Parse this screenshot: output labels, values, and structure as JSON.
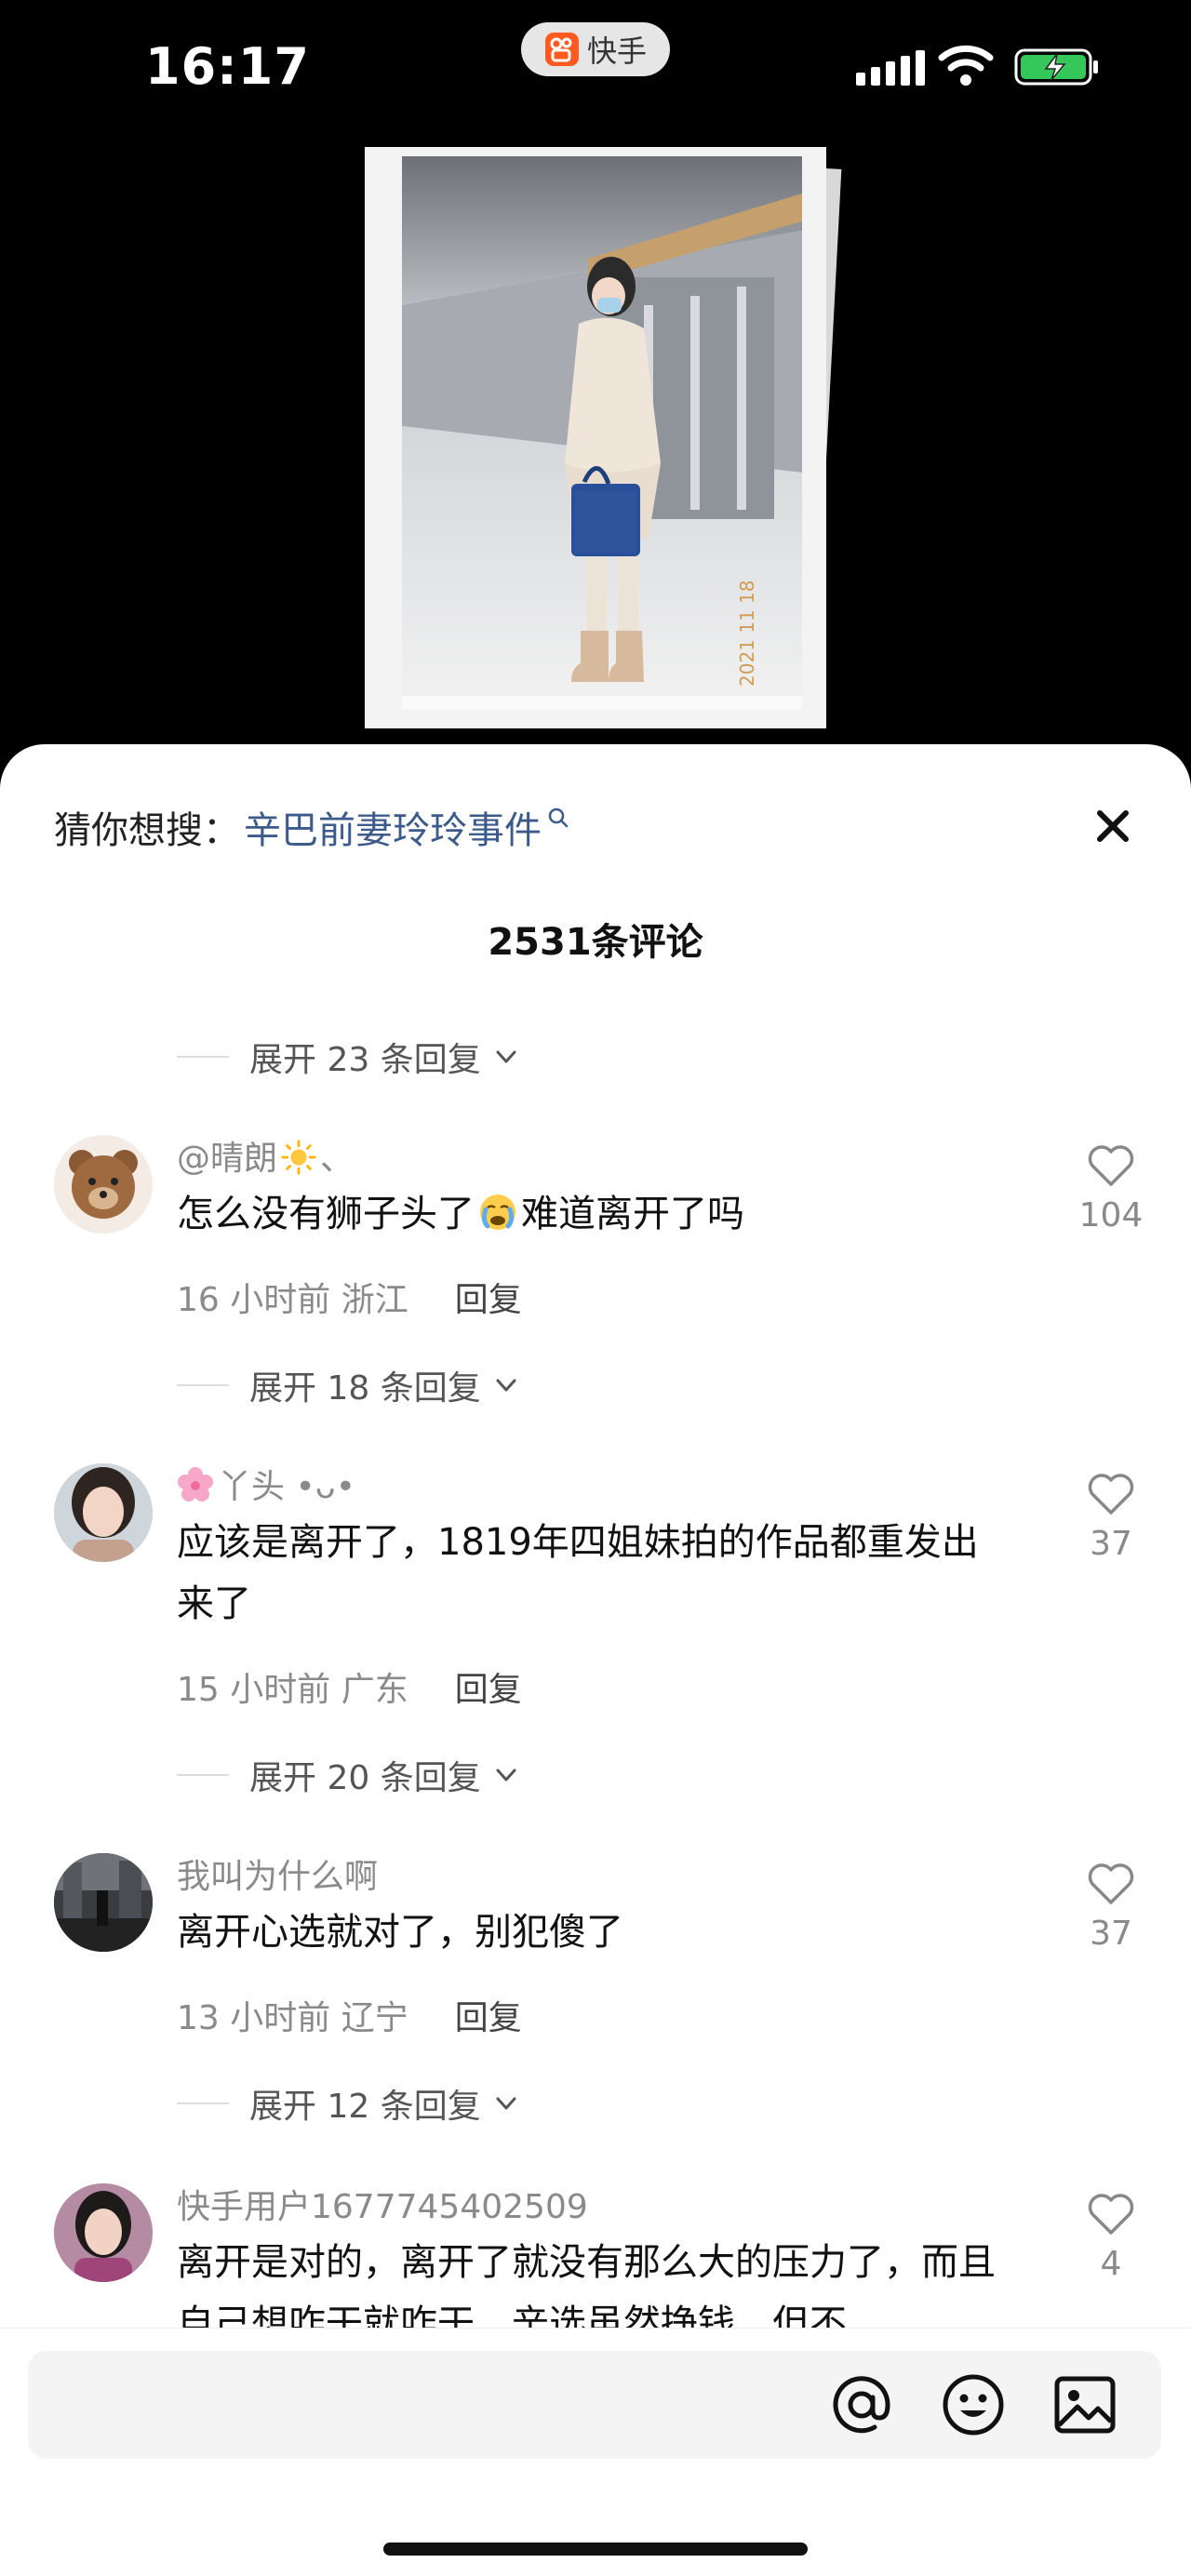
{
  "status_bar": {
    "time": "16:17",
    "app_name": "快手"
  },
  "sheet": {
    "guess_label": "猜你想搜：",
    "guess_keyword": "辛巴前妻玲玲事件",
    "comment_count": "2531条评论"
  },
  "photo": {
    "date_stamp": "2021 11 18"
  },
  "expand_replies": [
    {
      "label": "展开 23 条回复"
    },
    {
      "label": "展开 18 条回复"
    },
    {
      "label": "展开 20 条回复"
    },
    {
      "label": "展开 12 条回复"
    }
  ],
  "comments": [
    {
      "username": "@晴朗",
      "username_suffix": "、",
      "text_before": "怎么没有狮子头了",
      "text_after": "难道离开了吗",
      "meta": "16 小时前 浙江",
      "reply_label": "回复",
      "likes": "104"
    },
    {
      "username": "丫头 •ᴗ•",
      "text": "应该是离开了，1819年四姐妹拍的作品都重发出来了",
      "meta": "15 小时前 广东",
      "reply_label": "回复",
      "likes": "37"
    },
    {
      "username": "我叫为什么啊",
      "text": "离开心选就对了，别犯傻了",
      "meta": "13 小时前 辽宁",
      "reply_label": "回复",
      "likes": "37"
    },
    {
      "username": "快手用户1677745402509",
      "text": "离开是对的，离开了就没有那么大的压力了，而且自己想咋干就咋干，辛选虽然挣钱，但不",
      "likes": "4"
    }
  ],
  "icons": {
    "close": "close-icon",
    "mention": "at-icon",
    "emoji": "smiley-icon",
    "image": "image-icon",
    "like": "heart-icon"
  },
  "colors": {
    "keyword": "#3c5a8a",
    "secondary_text": "#8a8a8a",
    "battery": "#35c759"
  }
}
